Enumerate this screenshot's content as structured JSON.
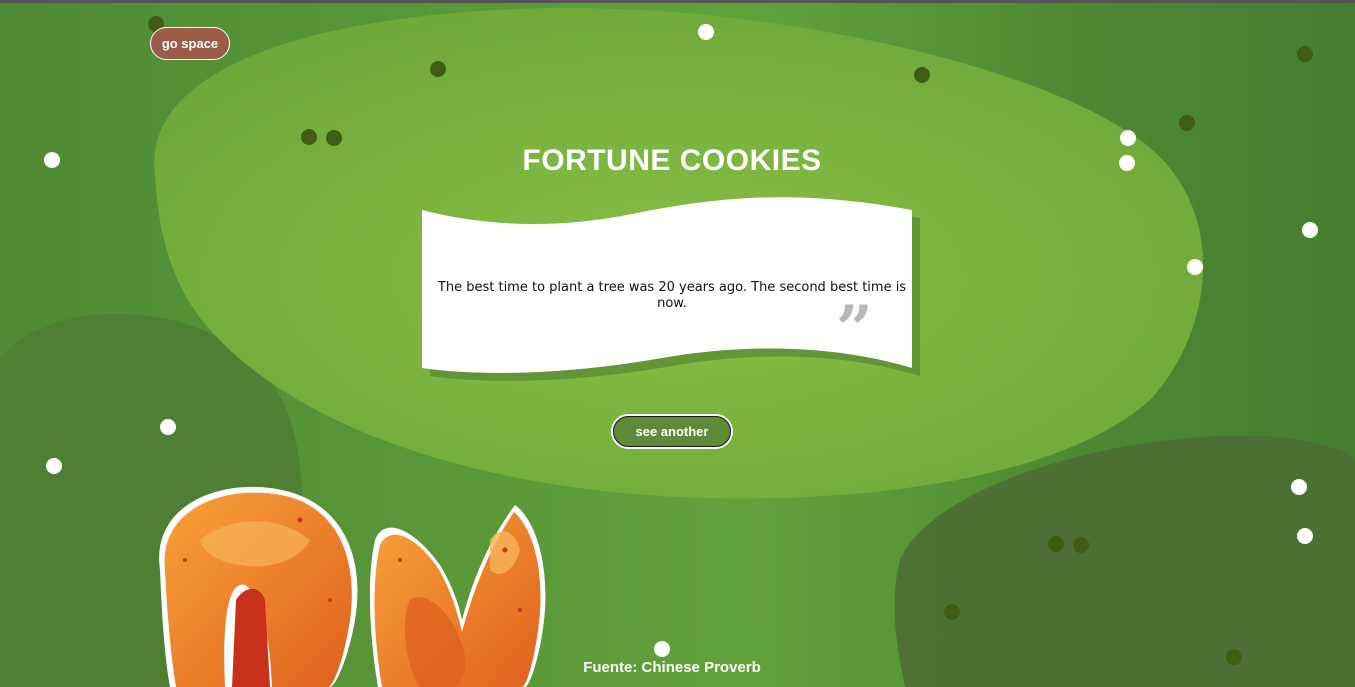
{
  "nav": {
    "go_space_label": "go space"
  },
  "header": {
    "title": "FORTUNE COOKIES"
  },
  "fortune": {
    "quote": "The best time to plant a tree was 20 years ago. The second best time is now.",
    "quote_mark": "”"
  },
  "actions": {
    "see_another_label": "see another"
  },
  "footer": {
    "source": "Fuente: Chinese Proverb"
  },
  "colors": {
    "background": "#5a9838",
    "blob_light": "#7fb63f",
    "blob_dark": "#4a7232",
    "button_go_space": "#9b5c48",
    "button_see_another": "#5f8a3a",
    "cookie_orange": "#f08a2a"
  }
}
